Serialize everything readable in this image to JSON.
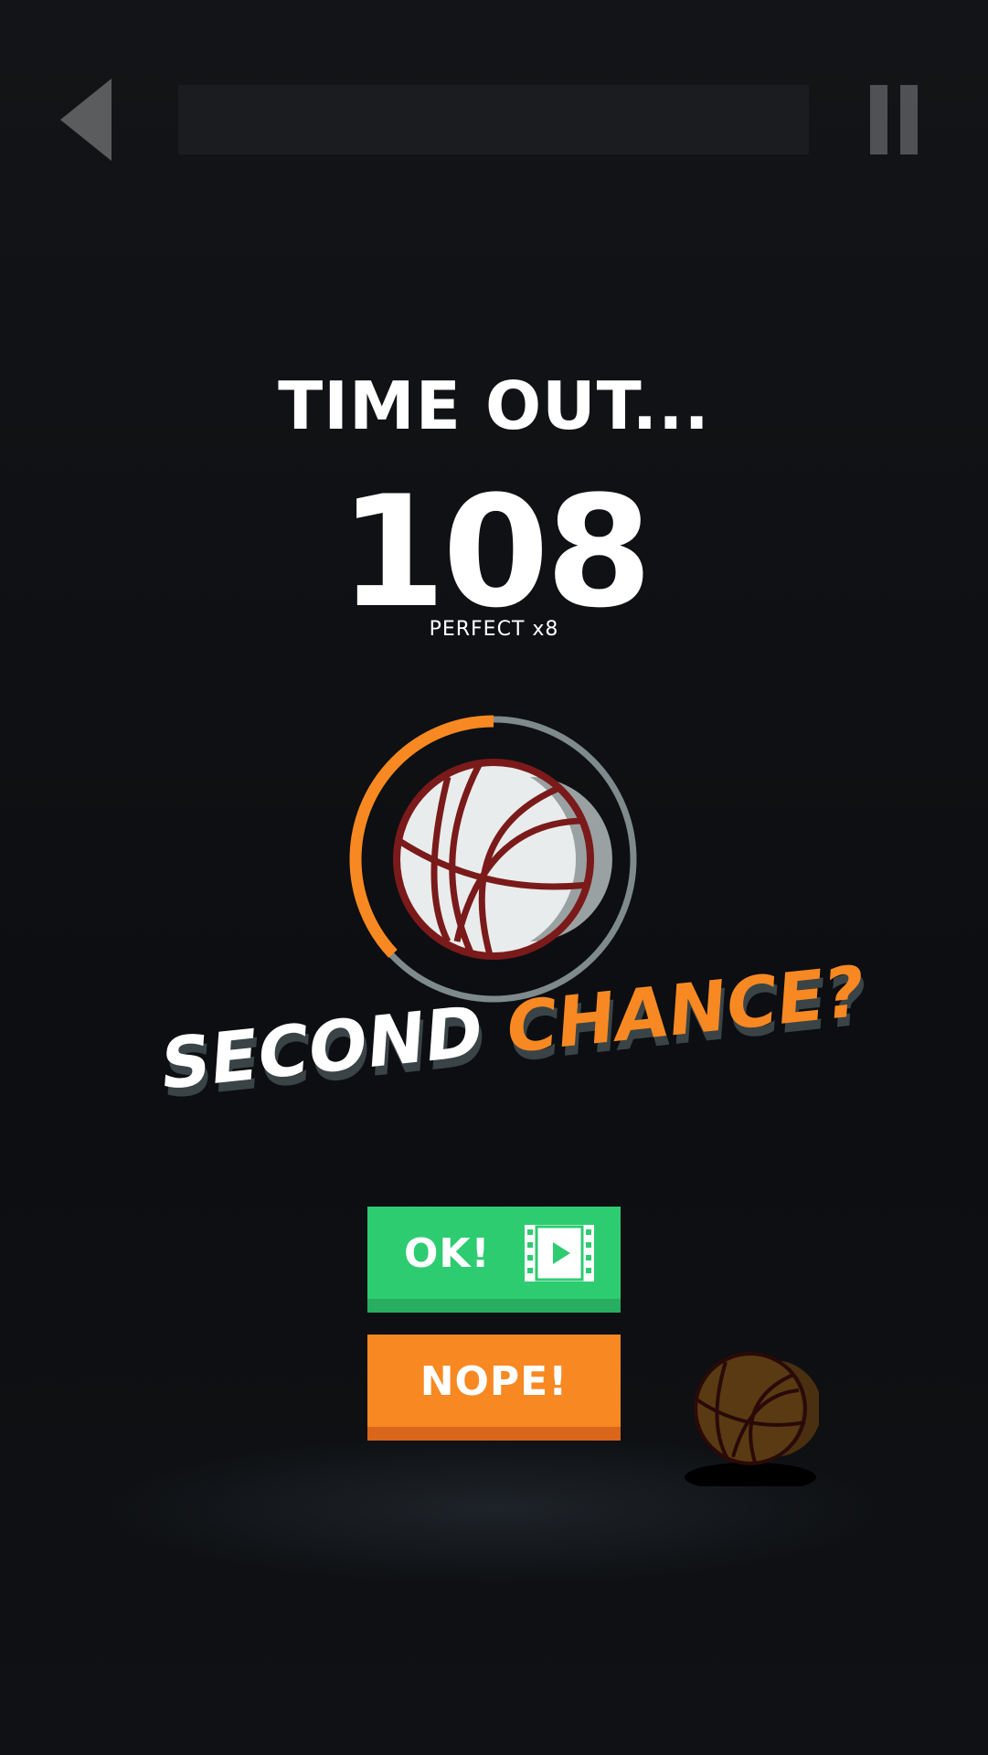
{
  "game": {
    "title": "TIME OUT...",
    "score": "108",
    "perfect_label": "PERFECT x8",
    "second_chance": {
      "word1": "SECOND",
      "word2": "CHANCE?"
    },
    "ok_button_label": "OK!",
    "nope_button_label": "NOPE!",
    "timer_remaining_fraction": 0.37,
    "level_progress_fraction": 0.0
  },
  "icons": {
    "back": "back-triangle-icon",
    "pause": "pause-icon",
    "video": "video-play-icon",
    "ball": "basketball-icon"
  },
  "colors": {
    "accent_orange": "#f88922",
    "ok_green": "#2ecc71",
    "ring_gray": "#7f8a8c",
    "ball_stroke": "#7a1a1a"
  }
}
